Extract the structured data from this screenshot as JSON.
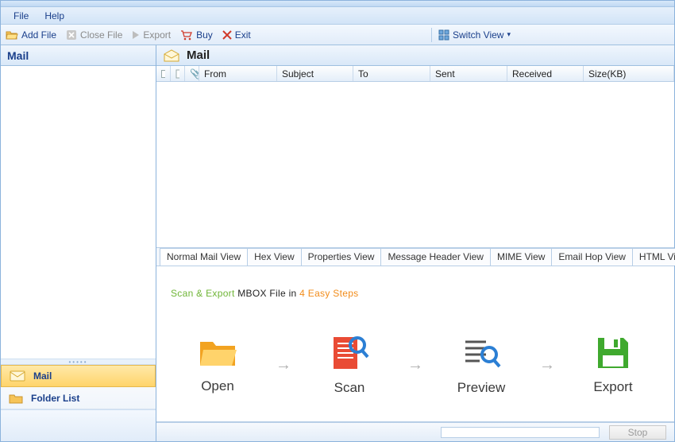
{
  "menu": {
    "file": "File",
    "help": "Help"
  },
  "toolbar": {
    "addfile": "Add File",
    "closefile": "Close File",
    "export": "Export",
    "buy": "Buy",
    "exit": "Exit",
    "switchview": "Switch View"
  },
  "left": {
    "title": "Mail",
    "nav_mail": "Mail",
    "nav_folder": "Folder List"
  },
  "mail": {
    "title": "Mail",
    "cols": {
      "from": "From",
      "subject": "Subject",
      "to": "To",
      "sent": "Sent",
      "received": "Received",
      "size": "Size(KB)"
    }
  },
  "tabs": {
    "normal": "Normal Mail View",
    "hex": "Hex View",
    "props": "Properties View",
    "header": "Message Header View",
    "mime": "MIME View",
    "hop": "Email Hop View",
    "html": "HTML View"
  },
  "preview": {
    "t1": "Scan & Export ",
    "t2": "MBOX File ",
    "t3": "in ",
    "t4": "4 Easy Steps",
    "s1": "Open",
    "s2": "Scan",
    "s3": "Preview",
    "s4": "Export"
  },
  "status": {
    "stop": "Stop"
  }
}
